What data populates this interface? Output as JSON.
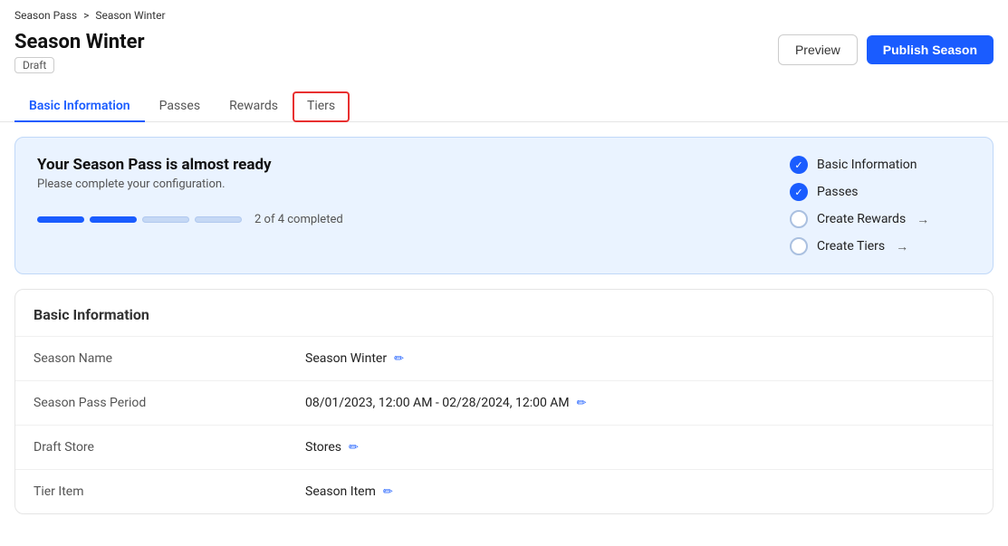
{
  "breadcrumb": {
    "parent": "Season Pass",
    "separator": ">",
    "current": "Season Winter"
  },
  "page": {
    "title": "Season Winter",
    "badge": "Draft"
  },
  "header": {
    "preview_label": "Preview",
    "publish_label": "Publish Season"
  },
  "tabs": [
    {
      "id": "basic-information",
      "label": "Basic Information",
      "active": true,
      "highlighted": false
    },
    {
      "id": "passes",
      "label": "Passes",
      "active": false,
      "highlighted": false
    },
    {
      "id": "rewards",
      "label": "Rewards",
      "active": false,
      "highlighted": false
    },
    {
      "id": "tiers",
      "label": "Tiers",
      "active": false,
      "highlighted": true
    }
  ],
  "progress_card": {
    "title": "Your Season Pass is almost ready",
    "subtitle": "Please complete your configuration.",
    "progress_text": "2 of 4 completed",
    "checklist": [
      {
        "id": "basic-info",
        "label": "Basic Information",
        "done": true,
        "has_arrow": false
      },
      {
        "id": "passes",
        "label": "Passes",
        "done": true,
        "has_arrow": false
      },
      {
        "id": "create-rewards",
        "label": "Create Rewards",
        "done": false,
        "has_arrow": true
      },
      {
        "id": "create-tiers",
        "label": "Create Tiers",
        "done": false,
        "has_arrow": true
      }
    ],
    "segments": [
      {
        "filled": true
      },
      {
        "filled": true
      },
      {
        "filled": false
      },
      {
        "filled": false
      }
    ]
  },
  "basic_information": {
    "title": "Basic Information",
    "rows": [
      {
        "label": "Season Name",
        "value": "Season Winter",
        "has_edit": true
      },
      {
        "label": "Season Pass Period",
        "value": "08/01/2023, 12:00 AM - 02/28/2024, 12:00 AM",
        "has_edit": true
      },
      {
        "label": "Draft Store",
        "value": "Stores",
        "has_edit": true
      },
      {
        "label": "Tier Item",
        "value": "Season Item",
        "has_edit": true
      }
    ]
  }
}
